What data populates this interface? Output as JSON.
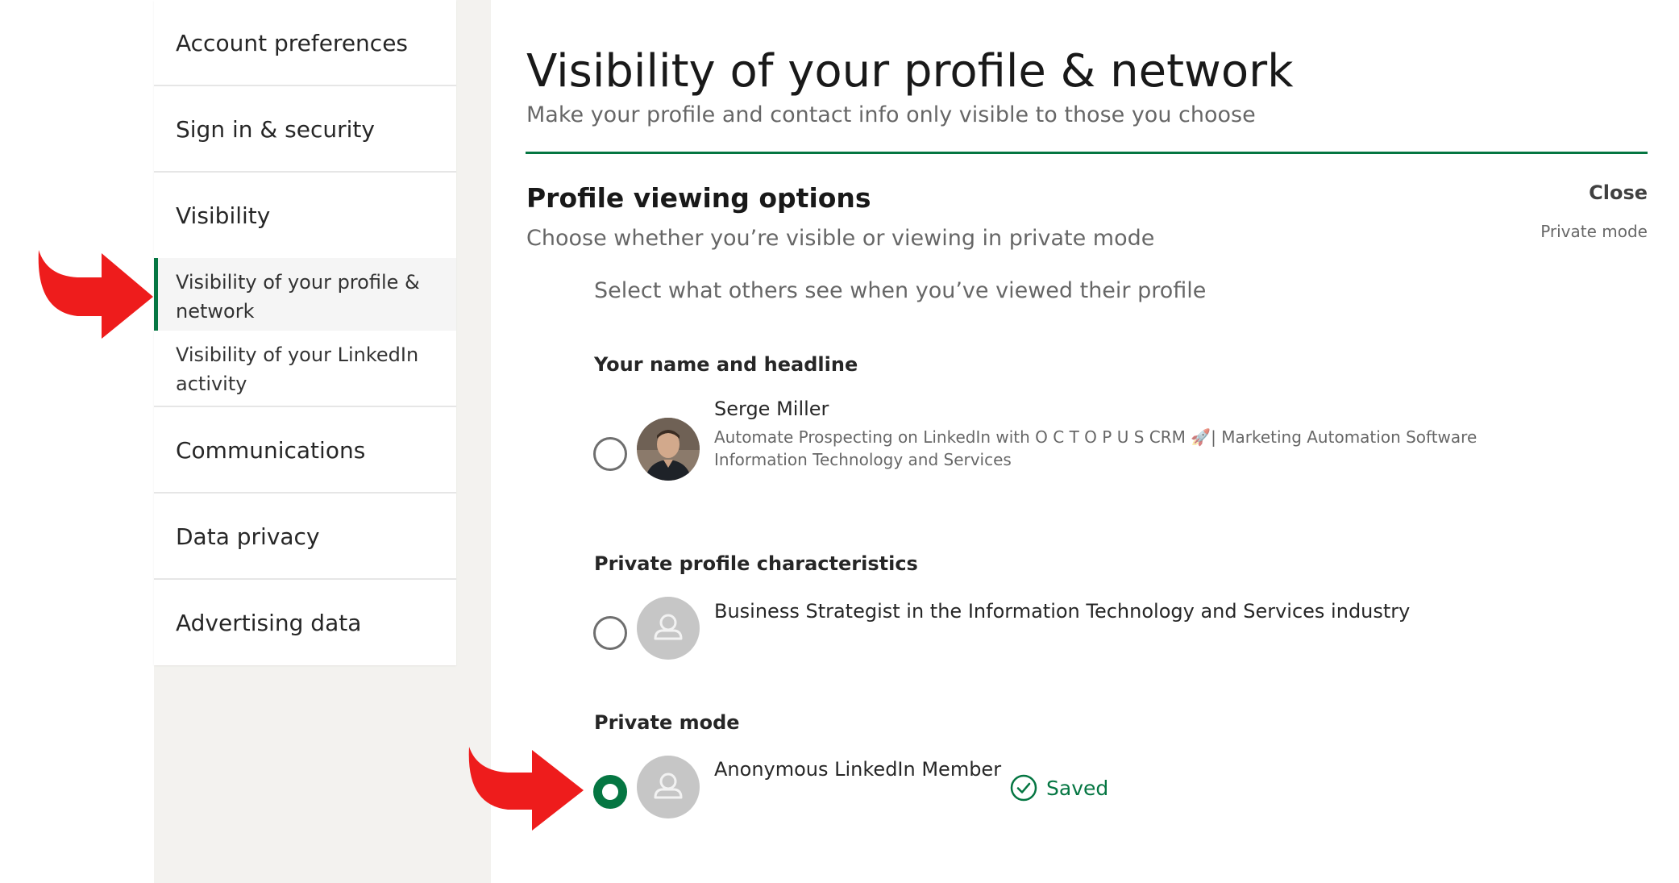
{
  "nav": {
    "account_preferences": "Account preferences",
    "sign_in_security": "Sign in & security",
    "visibility": "Visibility",
    "visibility_profile": "Visibility of your profile & network",
    "visibility_activity": "Visibility of your LinkedIn activity",
    "communications": "Communications",
    "data_privacy": "Data privacy",
    "advertising_data": "Advertising data"
  },
  "page": {
    "title": "Visibility of your profile & network",
    "subtitle": "Make your profile and contact info only visible to those you choose"
  },
  "section": {
    "title": "Profile viewing options",
    "description": "Choose whether you’re visible or viewing in private mode",
    "close_label": "Close",
    "current_setting": "Private mode",
    "prompt": "Select what others see when you’ve viewed their profile"
  },
  "options": {
    "name_headline": {
      "heading": "Your name and headline",
      "name": "Serge Miller",
      "headline": "Automate Prospecting on LinkedIn with O C T O P U S CRM 🚀| Marketing Automation Software",
      "industry": "Information Technology and Services",
      "selected": false
    },
    "characteristics": {
      "heading": "Private profile characteristics",
      "text": "Business Strategist in the Information Technology and Services industry",
      "selected": false
    },
    "private_mode": {
      "heading": "Private mode",
      "text": "Anonymous LinkedIn Member",
      "selected": true
    }
  },
  "status": {
    "saved_label": "Saved"
  },
  "colors": {
    "accent": "#057642",
    "arrow": "#ee1c1c",
    "sidebar_bg": "#f3f2ef"
  },
  "icons": [
    "check-circle-icon",
    "person-silhouette-icon",
    "arrow-pointer-icon"
  ]
}
